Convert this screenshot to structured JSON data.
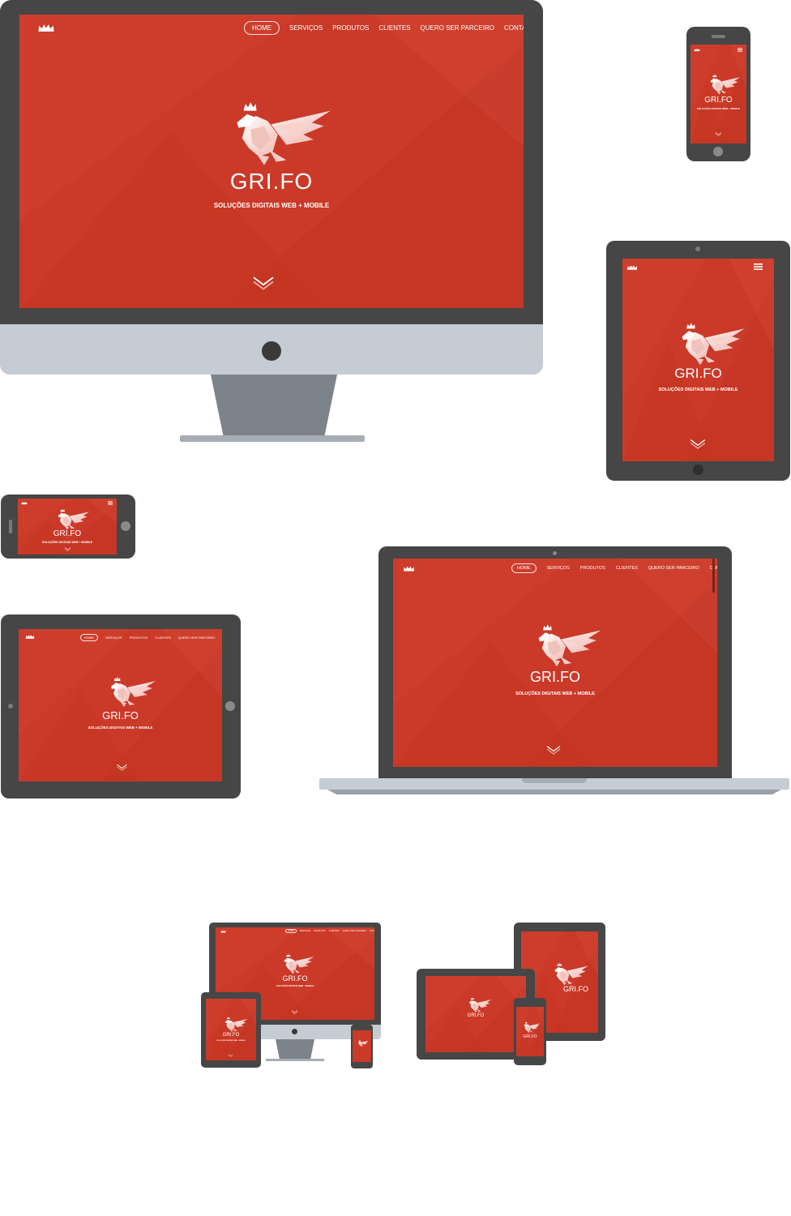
{
  "brand": {
    "name": "GRI.FO",
    "tagline": "SOLUÇÕES DIGITAIS WEB + MOBILE"
  },
  "nav": {
    "items": [
      "HOME",
      "SERVIÇOS",
      "PRODUTOS",
      "CLIENTES",
      "QUERO SER PARCEIRO",
      "CONTATO"
    ],
    "active": "HOME"
  },
  "colors": {
    "hero_red": "#cb3928",
    "device_dark": "#464646",
    "device_silver": "#c6ccd4",
    "stand_grey": "#7d838b"
  },
  "icons": [
    "crown-icon",
    "dragon-icon",
    "chevron-down-icon",
    "hamburger-icon",
    "home-button-icon",
    "camera-icon"
  ]
}
